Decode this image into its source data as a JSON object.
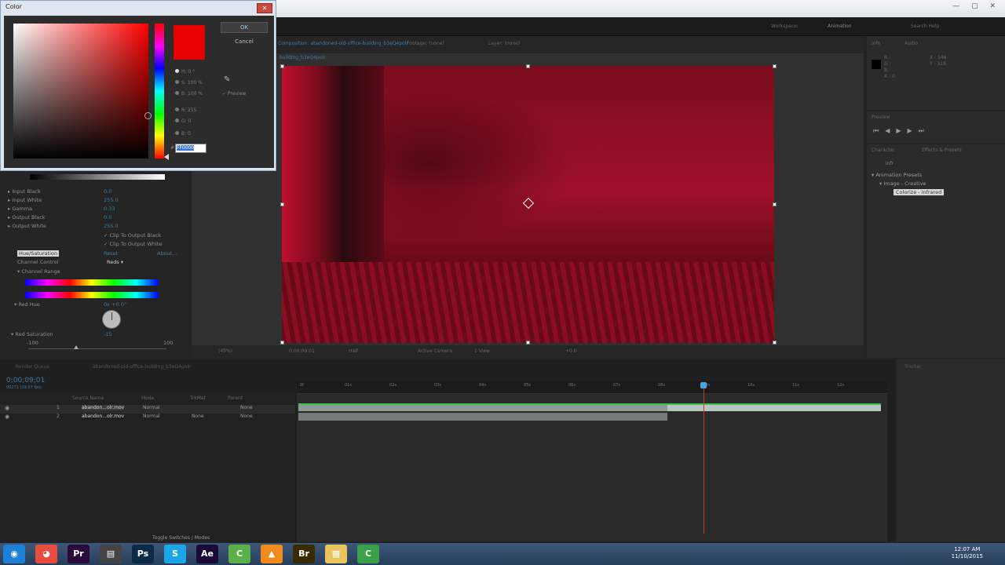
{
  "dialog": {
    "title": "Color",
    "close_label": "✕",
    "ok_label": "OK",
    "cancel_label": "Cancel",
    "preview_label": "Preview",
    "h_field": "H: 0 °",
    "s_field": "S: 100 %",
    "b_field": "B: 100 %",
    "r_field": "R: 255",
    "g_field": "G: 0",
    "bl_field": "B: 0",
    "hex_value": "FF0000",
    "swatch_color": "#e60000"
  },
  "effects": {
    "rows": [
      {
        "label": "▸ Input Black",
        "value": "0.0"
      },
      {
        "label": "▸ Input White",
        "value": "255.0"
      },
      {
        "label": "▸ Gamma",
        "value": "0.33"
      },
      {
        "label": "▸ Output Black",
        "value": "0.0"
      },
      {
        "label": "▸ Output White",
        "value": "255.0"
      }
    ],
    "clip_black": "✓ Clip To Output Black",
    "clip_white": "✓ Clip To Output White",
    "hue_sat_label": "Hue/Saturation",
    "reset": "Reset",
    "about": "About...",
    "channel_control_label": "Channel Control",
    "channel_control_value": "Reds",
    "channel_range_label": "▾ Channel Range",
    "red_hue_label": "▾ Red Hue",
    "red_hue_value": "0x +0.0°",
    "red_sat_label": "▾ Red Saturation",
    "red_sat_value": "-15",
    "min_val": "-100",
    "max_val": "100"
  },
  "viewer": {
    "tab1": "Composition: abandoned-old-office-building_b3eQ4poIr",
    "tab2": "Footage: (none)",
    "tab3": "Layer: (none)",
    "breadcrumb": "building_b3eQ4poIr",
    "zoom": "(49%)",
    "timecode": "0;00;09;01",
    "quality": "Half",
    "camera": "Active Camera",
    "views": "1 View",
    "offset": "+0.0"
  },
  "workspace": {
    "label": "Workspace:",
    "value": "Animation",
    "search": "Search Help"
  },
  "presets": {
    "search_value": "infr",
    "root": "▾ Animation Presets",
    "folder": "▾ Image - Creative",
    "selected": "Colorize - infrared"
  },
  "info": {
    "r": "R :",
    "g": "G :",
    "b": "B :",
    "a": "A : 0",
    "x": "X : 146",
    "y": "Y : 318",
    "panel1": "Info",
    "panel2": "Audio",
    "preview_title": "Preview",
    "presets_title": "Effects & Presets",
    "character_tab": "Character"
  },
  "timeline": {
    "tab_render": "Render Queue",
    "tab_comp": "abandoned-old-office-building_b3eQ4poIr",
    "timecode": "0;00;09;01",
    "fps": "00271 (29.97 fps)",
    "col_source": "Source Name",
    "col_mode": "Mode",
    "col_trkmat": "TrkMat",
    "col_parent": "Parent",
    "layers": [
      {
        "num": "1",
        "name": "abandon...olr.mov",
        "mode": "Normal",
        "trkmat": "",
        "parent": "None"
      },
      {
        "num": "2",
        "name": "abandon...olr.mov",
        "mode": "Normal",
        "trkmat": "None",
        "parent": "None"
      }
    ],
    "ticks": [
      "0f",
      "01s",
      "02s",
      "03s",
      "04s",
      "05s",
      "06s",
      "07s",
      "08s",
      "09s",
      "10s",
      "11s",
      "12s"
    ],
    "toggle_label": "Toggle Switches / Modes",
    "tracker_title": "Tracker"
  },
  "taskbar": {
    "clock_time": "12:07 AM",
    "clock_date": "11/10/2015",
    "icons": [
      {
        "label": "◉",
        "color": "#1e7fd6"
      },
      {
        "label": "◕",
        "color": "#e94c3d"
      },
      {
        "label": "Pr",
        "color": "#2a0a3a"
      },
      {
        "label": "▤",
        "color": "#444"
      },
      {
        "label": "Ps",
        "color": "#0b2a45"
      },
      {
        "label": "S",
        "color": "#1aa7e8"
      },
      {
        "label": "Ae",
        "color": "#1a0a3a"
      },
      {
        "label": "C",
        "color": "#5bb04a"
      },
      {
        "label": "▲",
        "color": "#f08a1a"
      },
      {
        "label": "Br",
        "color": "#3a2a00"
      },
      {
        "label": "▦",
        "color": "#e9c45a"
      },
      {
        "label": "C",
        "color": "#3aa04a"
      }
    ]
  }
}
